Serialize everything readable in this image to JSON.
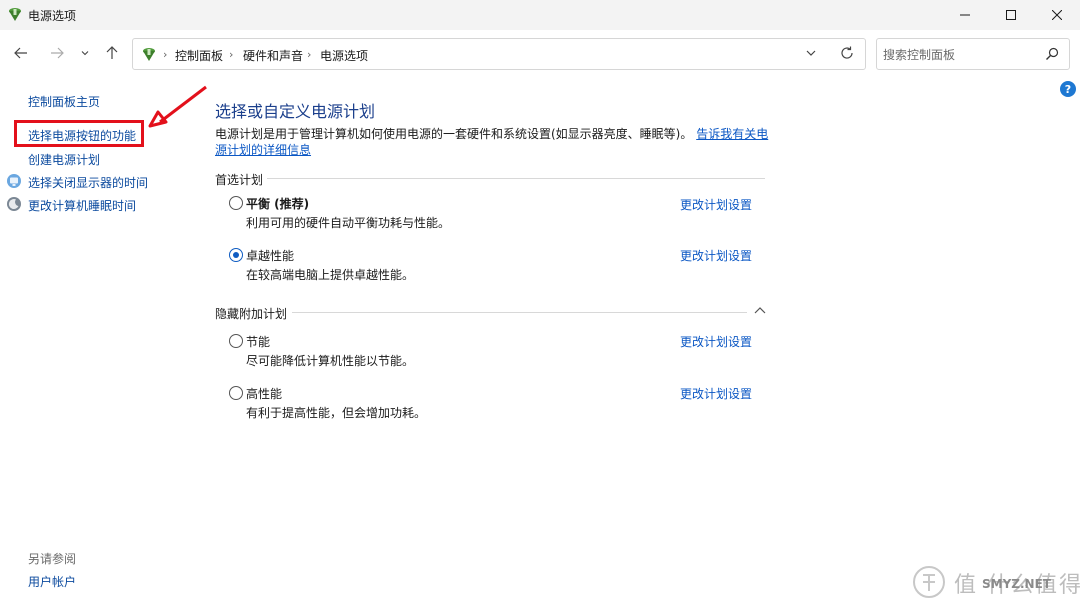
{
  "window": {
    "title": "电源选项",
    "minimize_icon": "minimize-icon",
    "maximize_icon": "maximize-icon",
    "close_icon": "close-icon"
  },
  "nav": {
    "breadcrumb": [
      "控制面板",
      "硬件和声音",
      "电源选项"
    ],
    "search_placeholder": "搜索控制面板"
  },
  "sidebar": {
    "links": [
      {
        "label": "控制面板主页"
      },
      {
        "label": "选择电源按钮的功能"
      },
      {
        "label": "创建电源计划"
      },
      {
        "label": "选择关闭显示器的时间"
      },
      {
        "label": "更改计算机睡眠时间"
      }
    ],
    "see_also_label": "另请参阅",
    "see_also_links": [
      {
        "label": "用户帐户"
      }
    ]
  },
  "main": {
    "title": "选择或自定义电源计划",
    "description": "电源计划是用于管理计算机如何使用电源的一套硬件和系统设置(如显示器亮度、睡眠等)。",
    "description_link": "告诉我有关电源计划的详细信息",
    "preferred_label": "首选计划",
    "hidden_label": "隐藏附加计划",
    "preferred_plans": [
      {
        "name": "平衡 (推荐)",
        "desc": "利用可用的硬件自动平衡功耗与性能。",
        "link": "更改计划设置",
        "selected": false
      },
      {
        "name": "卓越性能",
        "desc": "在较高端电脑上提供卓越性能。",
        "link": "更改计划设置",
        "selected": true
      }
    ],
    "hidden_plans": [
      {
        "name": "节能",
        "desc": "尽可能降低计算机性能以节能。",
        "link": "更改计划设置",
        "selected": false
      },
      {
        "name": "高性能",
        "desc": "有利于提高性能，但会增加功耗。",
        "link": "更改计划设置",
        "selected": false
      }
    ]
  },
  "watermark": {
    "text_cn": "值 什么值得买",
    "text_en": "SMYZ.NET"
  },
  "colors": {
    "link": "#0b57c4",
    "title": "#1b3f8c",
    "highlight": "#e3101b",
    "radio_checked": "#0f5cc2"
  }
}
